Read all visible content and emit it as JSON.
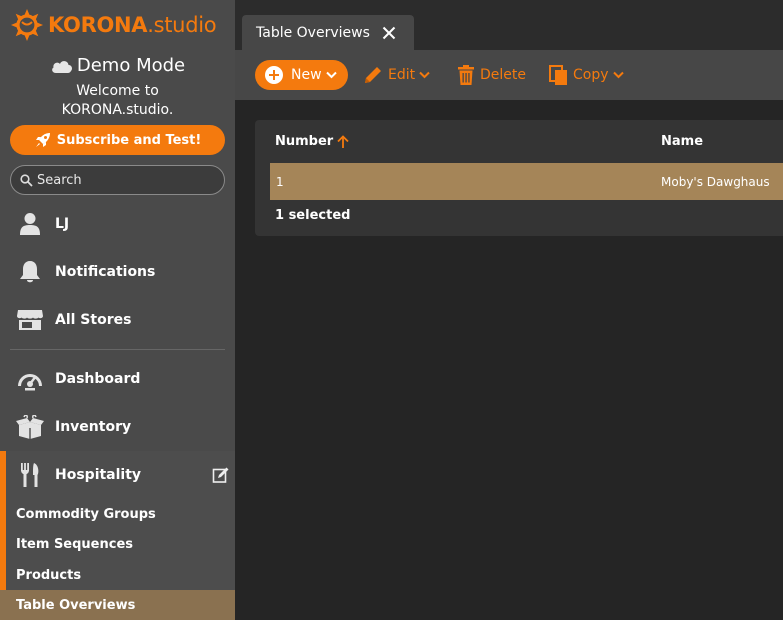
{
  "brand": {
    "name_bold": "KORONA",
    "name_rest": ".studio",
    "accent": "#f47a0e"
  },
  "sidebar": {
    "mode_title": "Demo Mode",
    "welcome_line1": "Welcome to",
    "welcome_line2": "KORONA.studio.",
    "subscribe_label": "Subscribe and Test!",
    "search_placeholder": "Search",
    "items": [
      {
        "label": "LJ",
        "icon": "user-icon"
      },
      {
        "label": "Notifications",
        "icon": "bell-icon"
      },
      {
        "label": "All Stores",
        "icon": "store-icon"
      },
      {
        "label": "Dashboard",
        "icon": "dashboard-icon"
      },
      {
        "label": "Inventory",
        "icon": "inventory-icon"
      },
      {
        "label": "Hospitality",
        "icon": "fork-knife-icon"
      }
    ],
    "subitems": [
      {
        "label": "Commodity Groups"
      },
      {
        "label": "Item Sequences"
      },
      {
        "label": "Products"
      },
      {
        "label": "Table Overviews"
      }
    ]
  },
  "main": {
    "tab_label": "Table Overviews",
    "toolbar": {
      "new_label": "New",
      "edit_label": "Edit",
      "delete_label": "Delete",
      "copy_label": "Copy"
    },
    "table": {
      "columns": [
        "Number",
        "Name"
      ],
      "rows": [
        {
          "number": "1",
          "name": "Moby's Dawghaus"
        }
      ],
      "footer": "1 selected"
    }
  }
}
